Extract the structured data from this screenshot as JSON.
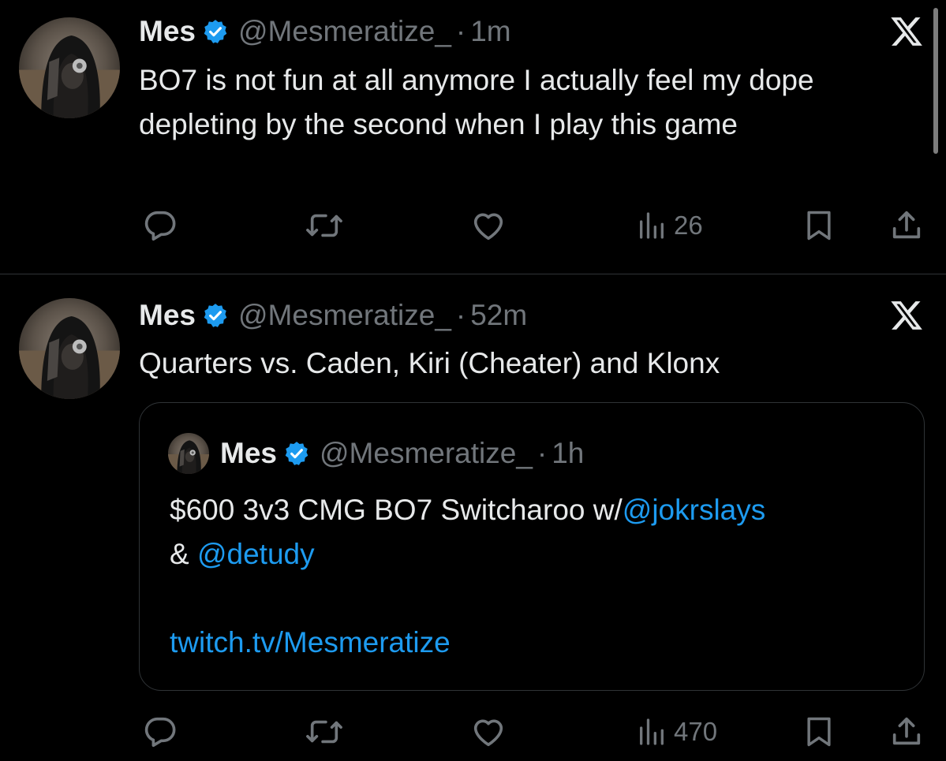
{
  "colors": {
    "background": "#000000",
    "text": "#e7e9ea",
    "muted": "#71767b",
    "link": "#1d9bf0",
    "verified": "#1d9bf0",
    "divider": "#2f3336"
  },
  "tweets": [
    {
      "author": {
        "name": "Mes",
        "handle": "@Mesmeratize_",
        "verified": true,
        "avatar": "hooded-figure-avatar"
      },
      "separator": "·",
      "time": "1m",
      "text": "BO7 is not fun at all anymore I actually feel my dope depleting by the second when I play this game",
      "actions": {
        "reply_icon": "reply-icon",
        "repost_icon": "repost-icon",
        "like_icon": "like-icon",
        "views_icon": "views-icon",
        "views_count": "26",
        "bookmark_icon": "bookmark-icon",
        "share_icon": "share-icon"
      }
    },
    {
      "author": {
        "name": "Mes",
        "handle": "@Mesmeratize_",
        "verified": true,
        "avatar": "hooded-figure-avatar"
      },
      "separator": "·",
      "time": "52m",
      "text": "Quarters vs. Caden, Kiri (Cheater) and Klonx",
      "quote": {
        "author": {
          "name": "Mes",
          "handle": "@Mesmeratize_",
          "verified": true
        },
        "separator": "·",
        "time": "1h",
        "text_part1": "$600 3v3 CMG BO7 Switcharoo w/",
        "mention1": "@jokrslays",
        "text_part2": "& ",
        "mention2": "@detudy",
        "link": "twitch.tv/Mesmeratize"
      },
      "actions": {
        "reply_icon": "reply-icon",
        "repost_icon": "repost-icon",
        "like_icon": "like-icon",
        "views_icon": "views-icon",
        "views_count": "470",
        "bookmark_icon": "bookmark-icon",
        "share_icon": "share-icon"
      }
    }
  ]
}
